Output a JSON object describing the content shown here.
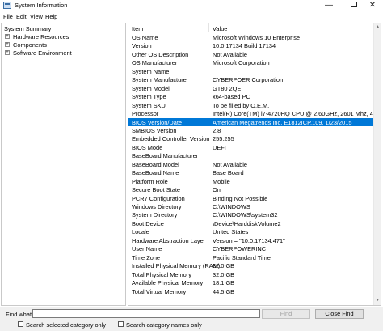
{
  "window": {
    "title": "System Information",
    "minimize": "—",
    "close": "✕"
  },
  "menu": [
    "File",
    "Edit",
    "View",
    "Help"
  ],
  "tree": {
    "root": "System Summary",
    "children": [
      {
        "label": "Hardware Resources",
        "expander": "+"
      },
      {
        "label": "Components",
        "expander": "+"
      },
      {
        "label": "Software Environment",
        "expander": "+"
      }
    ]
  },
  "table": {
    "columns": [
      "Item",
      "Value"
    ],
    "selected_index": 11,
    "rows": [
      [
        "OS Name",
        "Microsoft Windows 10 Enterprise"
      ],
      [
        "Version",
        "10.0.17134 Build 17134"
      ],
      [
        "Other OS Description",
        "Not Available"
      ],
      [
        "OS Manufacturer",
        "Microsoft Corporation"
      ],
      [
        "System Name",
        ""
      ],
      [
        "System Manufacturer",
        "CYBERPOER Corporation"
      ],
      [
        "System Model",
        "GT80 2QE"
      ],
      [
        "System Type",
        "x64-based PC"
      ],
      [
        "System SKU",
        "To be filled by O.E.M."
      ],
      [
        "Processor",
        "Intel(R) Core(TM) i7-4720HQ CPU @ 2.60GHz, 2601 Mhz, 4 Core(s), 8"
      ],
      [
        "BIOS Version/Date",
        "American Megatrends Inc. E1812ICP.109, 1/23/2015"
      ],
      [
        "SMBIOS Version",
        "2.8"
      ],
      [
        "Embedded Controller Version",
        "255.255"
      ],
      [
        "BIOS Mode",
        "UEFI"
      ],
      [
        "BaseBoard Manufacturer",
        ""
      ],
      [
        "BaseBoard Model",
        "Not Available"
      ],
      [
        "BaseBoard Name",
        "Base Board"
      ],
      [
        "Platform Role",
        "Mobile"
      ],
      [
        "Secure Boot State",
        "On"
      ],
      [
        "PCR7 Configuration",
        "Binding Not Possible"
      ],
      [
        "Windows Directory",
        "C:\\WINDOWS"
      ],
      [
        "System Directory",
        "C:\\WINDOWS\\system32"
      ],
      [
        "Boot Device",
        "\\Device\\HarddiskVolume2"
      ],
      [
        "Locale",
        "United States"
      ],
      [
        "Hardware Abstraction Layer",
        "Version = \"10.0.17134.471\""
      ],
      [
        "User Name",
        "CYBERPOWERINC"
      ],
      [
        "Time Zone",
        "Pacific Standard Time"
      ],
      [
        "Installed Physical Memory (RAM)",
        "32.0 GB"
      ],
      [
        "Total Physical Memory",
        "32.0 GB"
      ],
      [
        "Available Physical Memory",
        "18.1 GB"
      ],
      [
        "Total Virtual Memory",
        "44.5 GB"
      ]
    ]
  },
  "find": {
    "label": "Find what:",
    "value": "",
    "find_button": "Find",
    "close_find_button": "Close Find",
    "search_selected_label": "Search selected category only",
    "search_names_label": "Search category names only"
  },
  "colors": {
    "selection": "#0078d7"
  }
}
